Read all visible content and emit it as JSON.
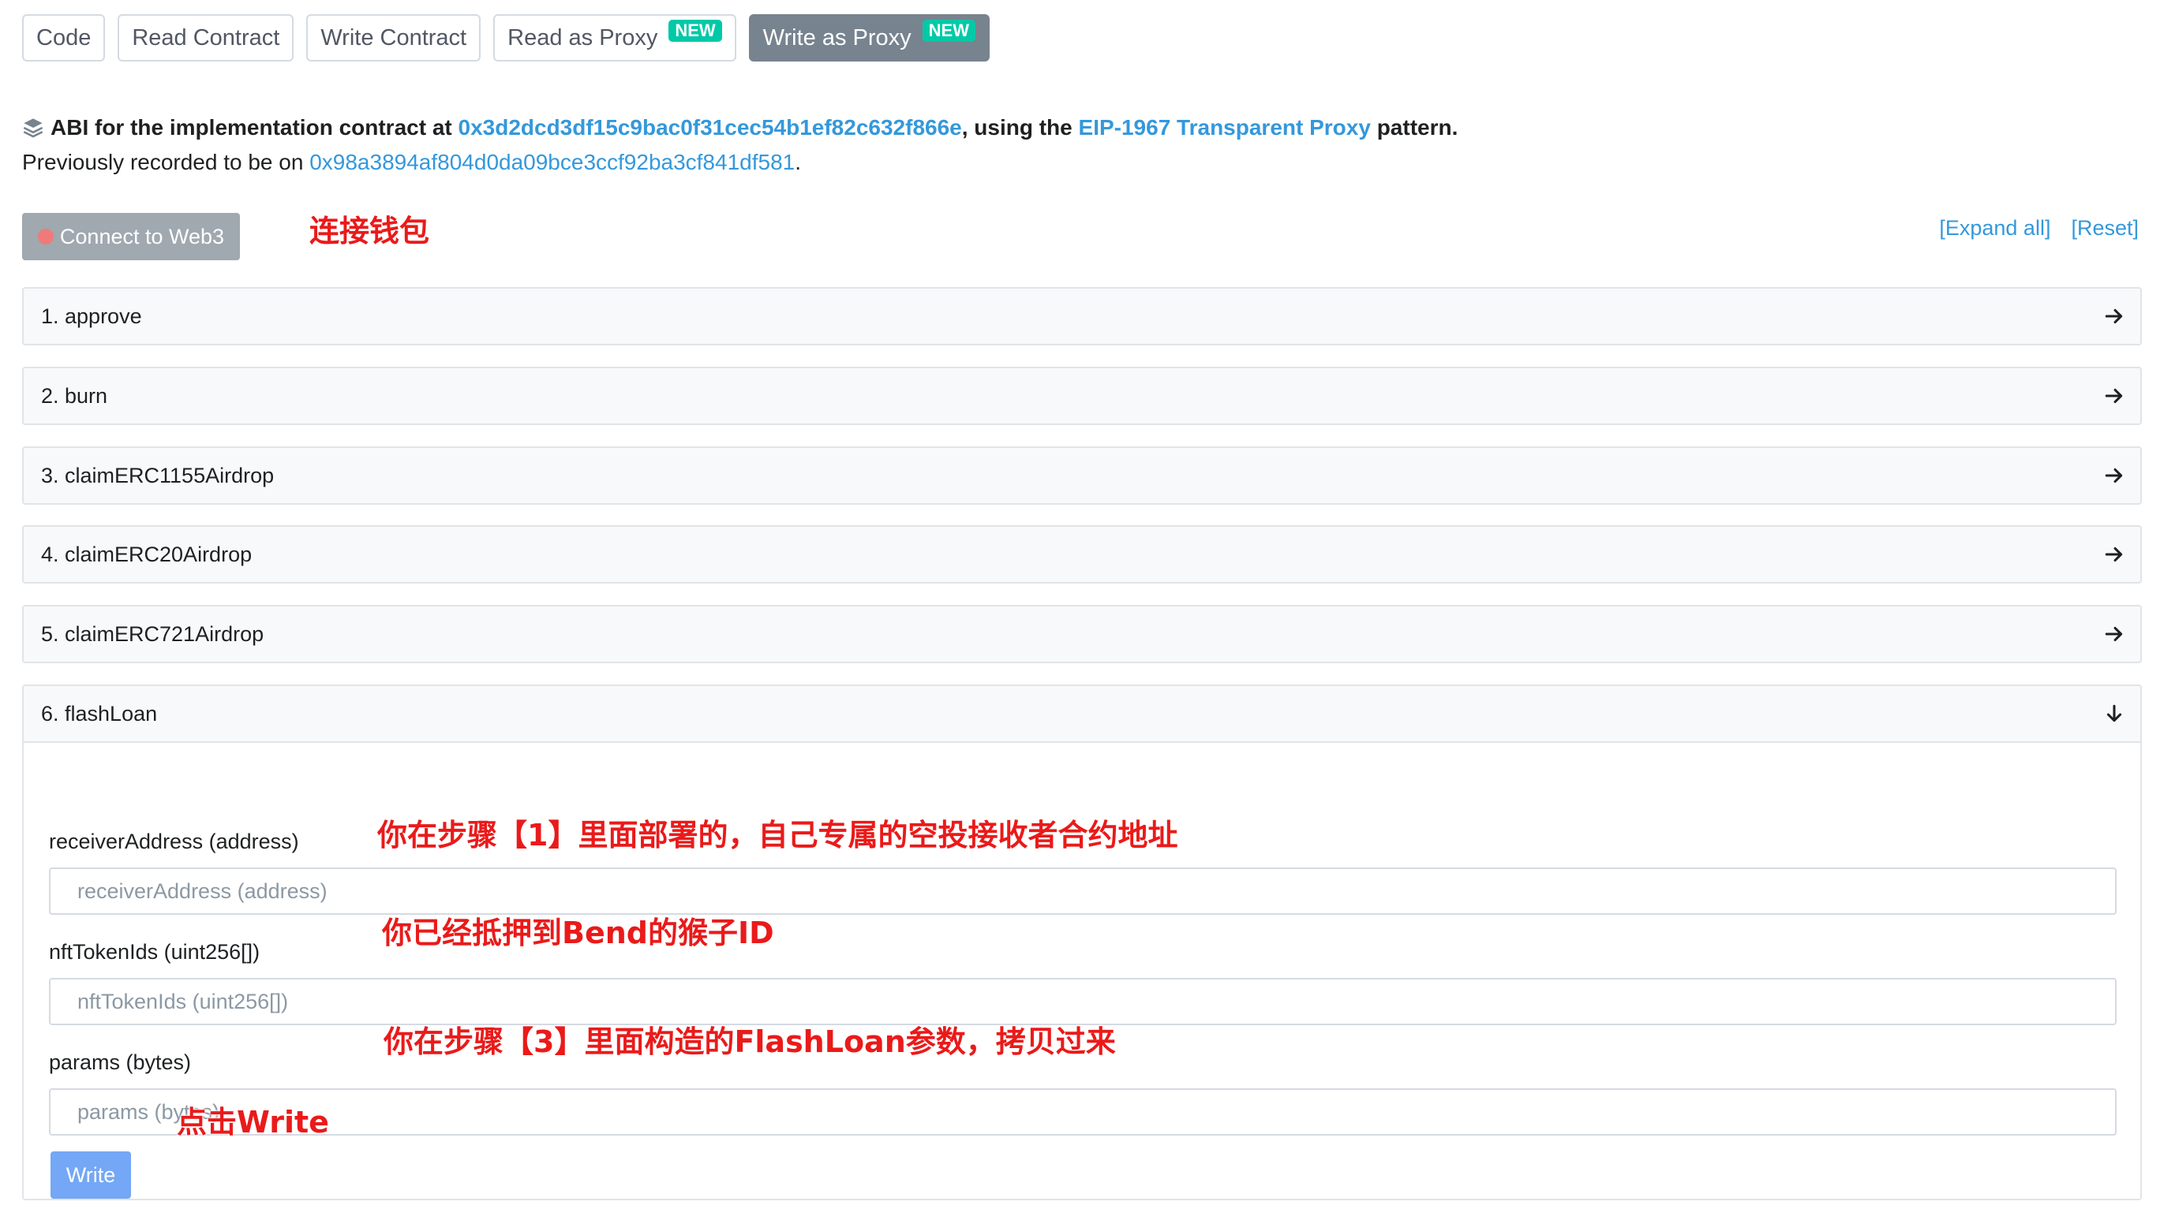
{
  "tabs": [
    {
      "label": "Code"
    },
    {
      "label": "Read Contract"
    },
    {
      "label": "Write Contract"
    },
    {
      "label": "Read as Proxy",
      "badge": "NEW"
    },
    {
      "label": "Write as Proxy",
      "badge": "NEW"
    }
  ],
  "abi": {
    "prefix": "ABI for the implementation contract at",
    "implementation_address": "0x3d2dcd3df15c9bac0f31cec54b1ef82c632f866e",
    "middle": ", using the",
    "pattern_link": "EIP-1967 Transparent Proxy",
    "suffix": "pattern.",
    "prev_prefix": "Previously recorded to be on",
    "prev_address": "0x98a3894af804d0da09bce3ccf92ba3cf841df581",
    "prev_suffix": "."
  },
  "connect": {
    "label": "Connect to Web3"
  },
  "links": {
    "expand_all": "[Expand all]",
    "reset": "[Reset]"
  },
  "functions": [
    {
      "label": "1. approve"
    },
    {
      "label": "2. burn"
    },
    {
      "label": "3. claimERC1155Airdrop"
    },
    {
      "label": "4. claimERC20Airdrop"
    },
    {
      "label": "5. claimERC721Airdrop"
    },
    {
      "label": "6. flashLoan"
    }
  ],
  "flashloan": {
    "fields": [
      {
        "label": "receiverAddress (address)",
        "placeholder": "receiverAddress (address)",
        "value": ""
      },
      {
        "label": "nftTokenIds (uint256[])",
        "placeholder": "nftTokenIds (uint256[])",
        "value": ""
      },
      {
        "label": "params (bytes)",
        "placeholder": "params (bytes)",
        "value": ""
      }
    ],
    "write_label": "Write"
  },
  "annotations": {
    "connect": "连接钱包",
    "receiver": "你在步骤【1】里面部署的，自己专属的空投接收者合约地址",
    "nft_ids": "你已经抵押到Bend的猴子ID",
    "params": "你在步骤【3】里面构造的FlashLoan参数，拷贝过来",
    "write": "点击Write"
  },
  "colors": {
    "link": "#3498db",
    "annotation": "#ea1a1a",
    "active_tab": "#77838f",
    "badge": "#00c9a7",
    "write_button": "#74a7f5"
  }
}
